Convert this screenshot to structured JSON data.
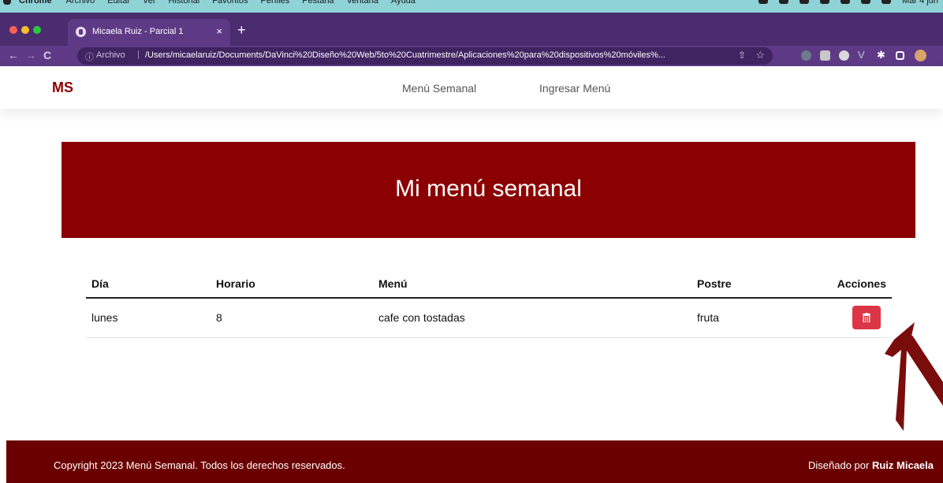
{
  "browser": {
    "tab_title": "Micaela Ruiz - Parcial 1",
    "tab_close": "×",
    "new_tab": "+",
    "scheme_label": "Archivo",
    "url": "/Users/micaelaruiz/Documents/DaVinci%20Diseño%20Web/5to%20Cuatrimestre/Aplicaciones%20para%20dispositivos%20móviles%...",
    "colors": {
      "frame": "#4b2c6e",
      "toolbar": "#5e3a86"
    }
  },
  "navbar": {
    "brand": "MS",
    "links": [
      "Menú Semanal",
      "Ingresar Menú"
    ]
  },
  "hero": {
    "title": "Mi menú semanal"
  },
  "table": {
    "headers": [
      "Día",
      "Horario",
      "Menú",
      "Postre",
      "Acciones"
    ],
    "rows": [
      {
        "dia": "lunes",
        "horario": "8",
        "menu": "cafe con tostadas",
        "postre": "fruta",
        "action_icon": "trash-icon"
      }
    ]
  },
  "footer": {
    "copyright": "Copyright 2023 Menú Semanal. Todos los derechos reservados.",
    "credit_prefix": "Diseñado por ",
    "credit_name": "Ruiz Micaela"
  },
  "colors": {
    "primary": "#8b0000",
    "footer": "#6b0000",
    "danger": "#dc3545",
    "annotation": "#7a0c0c"
  }
}
